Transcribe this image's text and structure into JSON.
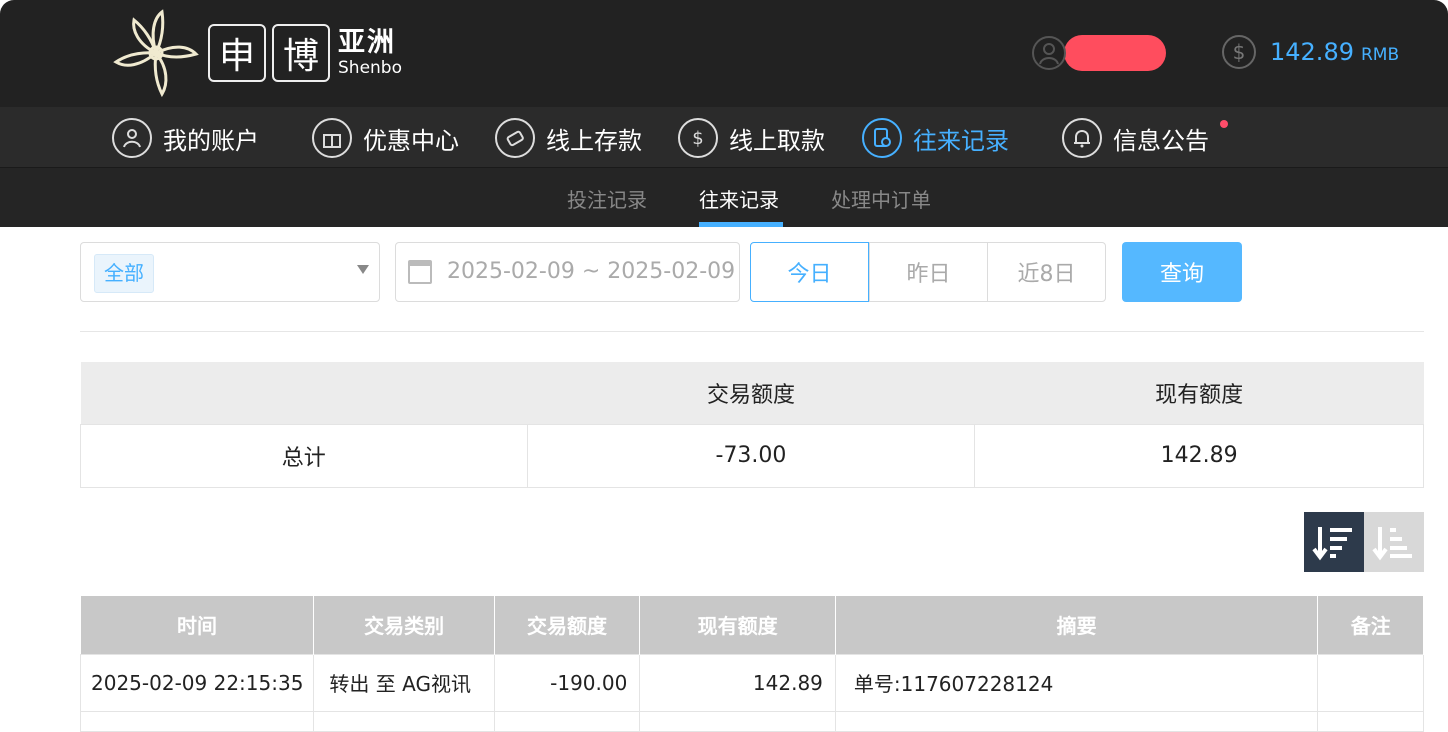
{
  "brand": {
    "box1": "申",
    "box2": "博",
    "name_cn": "亚洲",
    "name_en": "Shenbo"
  },
  "account": {
    "balance": "142.89",
    "currency": "RMB"
  },
  "main_nav": [
    {
      "label": "我的账户",
      "icon": "user-icon"
    },
    {
      "label": "优惠中心",
      "icon": "gift-icon"
    },
    {
      "label": "线上存款",
      "icon": "deposit-icon"
    },
    {
      "label": "线上取款",
      "icon": "withdraw-icon"
    },
    {
      "label": "往来记录",
      "icon": "records-icon",
      "active": true
    },
    {
      "label": "信息公告",
      "icon": "bell-icon"
    }
  ],
  "sub_nav": [
    {
      "label": "投注记录"
    },
    {
      "label": "往来记录",
      "active": true
    },
    {
      "label": "处理中订单"
    }
  ],
  "filters": {
    "type_tag": "全部",
    "date_range": "2025-02-09 ~ 2025-02-09",
    "range_buttons": [
      "今日",
      "昨日",
      "近8日"
    ],
    "query_label": "查询"
  },
  "summary": {
    "headers": [
      "",
      "交易额度",
      "现有额度"
    ],
    "row": [
      "总计",
      "-73.00",
      "142.89"
    ]
  },
  "records": {
    "headers": [
      "时间",
      "交易类别",
      "交易额度",
      "现有额度",
      "摘要",
      "备注"
    ],
    "rows": [
      [
        "2025-02-09 22:15:35",
        "转出 至 AG视讯",
        "-190.00",
        "142.89",
        "单号:117607228124",
        ""
      ]
    ]
  },
  "colors": {
    "accent": "#46b0ff",
    "header_bg": "#222222",
    "redaction": "#ff4d5e",
    "sort_active": "#2d3a4b"
  }
}
